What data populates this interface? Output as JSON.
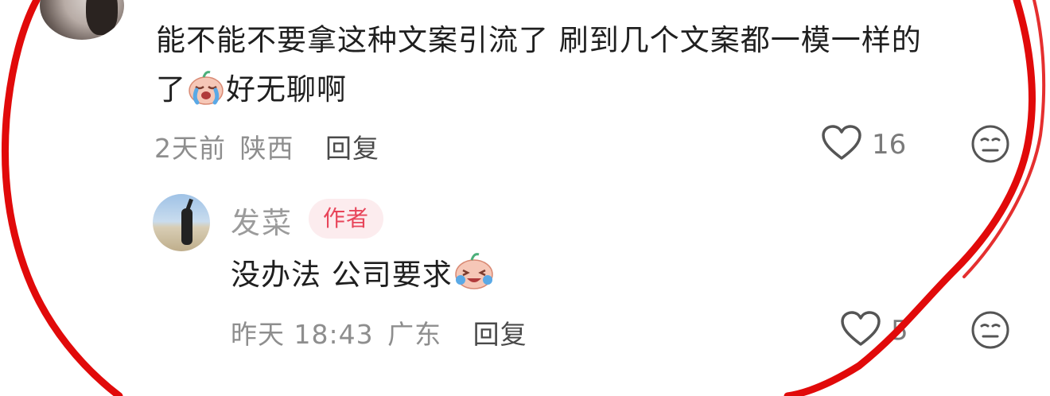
{
  "comment": {
    "text_line1": "能不能不要拿这种文案引流了 刷到几个文案都一模一样的",
    "text_line2_before": "了",
    "text_line2_after": "好无聊啊",
    "emoji_name": "crying-face-emoji",
    "meta_time": "2天前",
    "meta_location": "陕西",
    "reply_label": "回复",
    "like_count": "16",
    "heart_icon": "heart-outline-icon",
    "dislike_icon": "meh-face-icon"
  },
  "reply": {
    "author": "发菜",
    "badge": "作者",
    "text": "没办法 公司要求",
    "emoji_name": "laugh-cry-emoji",
    "meta_time": "昨天 18:43",
    "meta_location": "广东",
    "reply_label": "回复",
    "like_count": "5",
    "heart_icon": "heart-outline-icon",
    "dislike_icon": "meh-face-icon"
  },
  "colors": {
    "annotation_red": "#e10a0a",
    "badge_text": "#e8455a",
    "badge_bg": "#fcecee",
    "meta_gray": "#8e8e8e"
  }
}
